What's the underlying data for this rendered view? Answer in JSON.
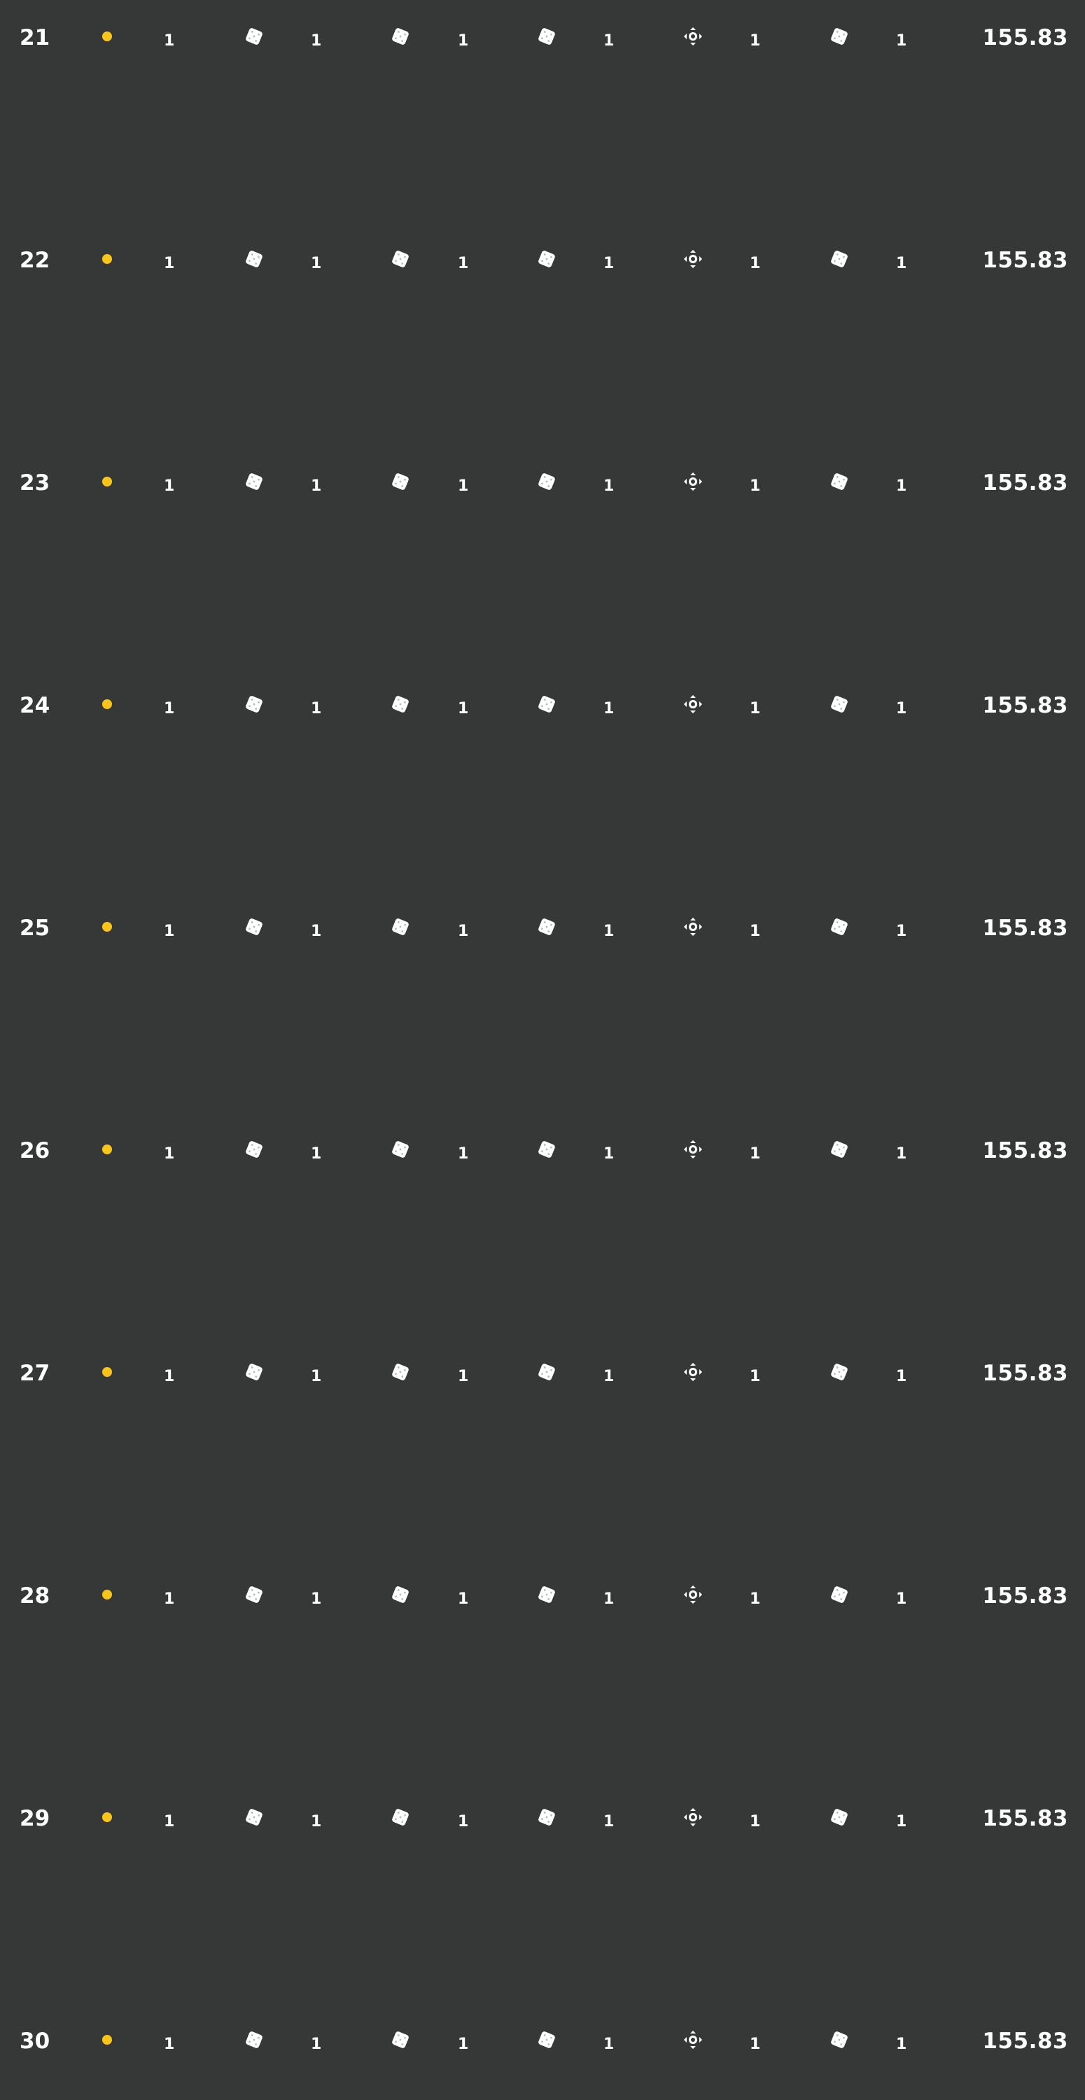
{
  "colors": {
    "background": "#363737",
    "text": "#ffffff",
    "dot": "#f9c51a"
  },
  "columns": [
    {
      "icon": "dice-icon",
      "count": "1"
    },
    {
      "icon": "dice-icon",
      "count": "1"
    },
    {
      "icon": "dice-icon",
      "count": "1"
    },
    {
      "icon": "target-icon",
      "count": "1"
    },
    {
      "icon": "dice-icon",
      "count": "1"
    },
    {
      "icon": "dice-icon",
      "count": "1"
    }
  ],
  "rows": [
    {
      "number": "21",
      "first_count": "1",
      "score": "155.83"
    },
    {
      "number": "22",
      "first_count": "1",
      "score": "155.83"
    },
    {
      "number": "23",
      "first_count": "1",
      "score": "155.83"
    },
    {
      "number": "24",
      "first_count": "1",
      "score": "155.83"
    },
    {
      "number": "25",
      "first_count": "1",
      "score": "155.83"
    },
    {
      "number": "26",
      "first_count": "1",
      "score": "155.83"
    },
    {
      "number": "27",
      "first_count": "1",
      "score": "155.83"
    },
    {
      "number": "28",
      "first_count": "1",
      "score": "155.83"
    },
    {
      "number": "29",
      "first_count": "1",
      "score": "155.83"
    },
    {
      "number": "30",
      "first_count": "1",
      "score": "155.83"
    }
  ]
}
